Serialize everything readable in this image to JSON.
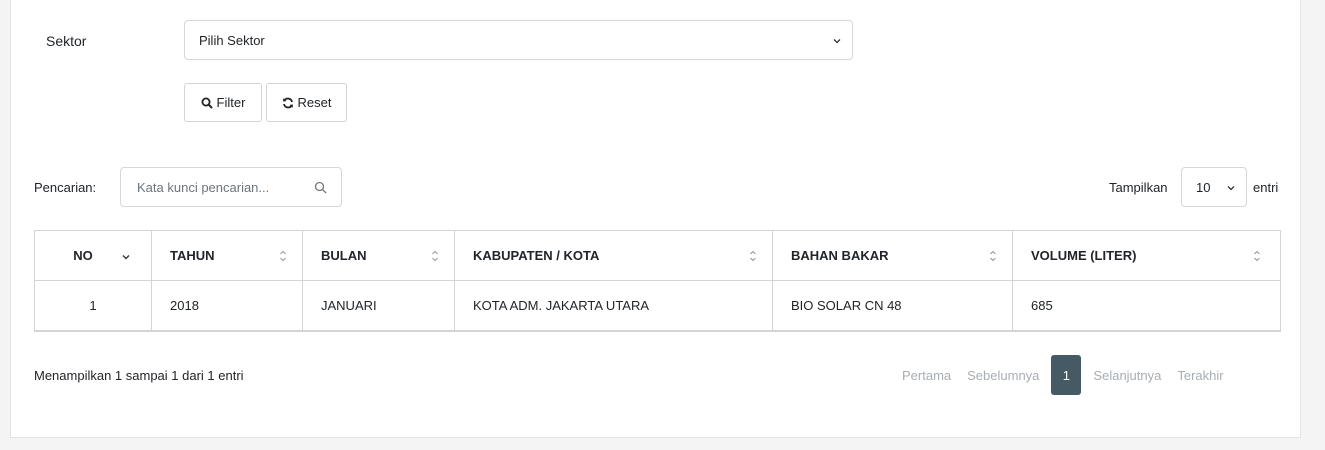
{
  "filter": {
    "sector_label": "Sektor",
    "sector_select_value": "Pilih Sektor",
    "filter_button": "Filter",
    "reset_button": "Reset"
  },
  "toolbar": {
    "search_label": "Pencarian:",
    "search_placeholder": "Kata kunci pencarian...",
    "show_label": "Tampilkan",
    "page_length": "10",
    "entries_label": "entri"
  },
  "table": {
    "columns": [
      "NO",
      "TAHUN",
      "BULAN",
      "KABUPATEN / KOTA",
      "BAHAN BAKAR",
      "VOLUME (LITER)"
    ],
    "rows": [
      [
        "1",
        "2018",
        "JANUARI",
        "KOTA ADM. JAKARTA UTARA",
        "BIO SOLAR CN 48",
        "685"
      ]
    ]
  },
  "footer": {
    "info": "Menampilkan 1 sampai 1 dari 1 entri",
    "pagination": {
      "first": "Pertama",
      "previous": "Sebelumnya",
      "current": "1",
      "next": "Selanjutnya",
      "last": "Terakhir"
    }
  },
  "colors": {
    "active_page": "#455a64",
    "disabled_page_text": "#a8aeb4"
  }
}
